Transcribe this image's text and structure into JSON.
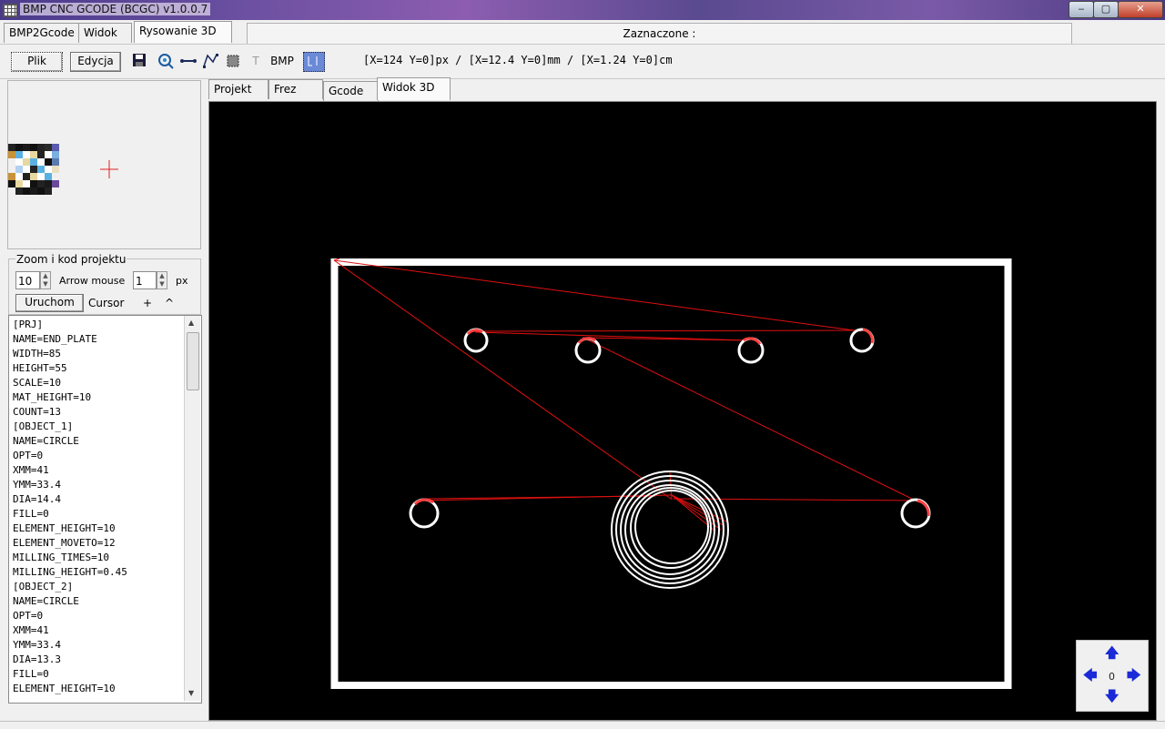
{
  "window": {
    "title": "BMP CNC GCODE (BCGC) v1.0.0.7",
    "min": "‒",
    "max": "▢",
    "close": "✕"
  },
  "top_tabs": [
    "BMP2Gcode",
    "Widok",
    "Rysowanie 3D"
  ],
  "selection_label": "Zaznaczone :",
  "toolbar": {
    "plik": "Plik",
    "edycja": "Edycja",
    "text_tool": "T",
    "bmp_tool": "BMP",
    "coords": "[X=124 Y=0]px / [X=12.4 Y=0]mm / [X=1.24 Y=0]cm"
  },
  "zoom_group": {
    "legend": "Zoom i kod projektu",
    "zoom_value": "10",
    "arrow_mouse_label": "Arrow mouse",
    "arrow_value": "1",
    "unit": "px",
    "run_button": "Uruchom",
    "cursor_label": "Cursor",
    "plus": "+",
    "caret": "^"
  },
  "code_lines": [
    "[PRJ]",
    "NAME=END_PLATE",
    "WIDTH=85",
    "HEIGHT=55",
    "SCALE=10",
    "MAT_HEIGHT=10",
    "COUNT=13",
    "[OBJECT_1]",
    "NAME=CIRCLE",
    "OPT=0",
    "XMM=41",
    "YMM=33.4",
    "DIA=14.4",
    "FILL=0",
    "ELEMENT_HEIGHT=10",
    "ELEMENT_MOVETO=12",
    "MILLING_TIMES=10",
    "MILLING_HEIGHT=0.45",
    "[OBJECT_2]",
    "NAME=CIRCLE",
    "OPT=0",
    "XMM=41",
    "YMM=33.4",
    "DIA=13.3",
    "FILL=0",
    "ELEMENT_HEIGHT=10"
  ],
  "inner_tabs": [
    "Projekt",
    "Frez",
    "Gcode",
    "Widok 3D"
  ],
  "nav_pad": {
    "center": "0",
    "up": "🡅",
    "down": "🡇",
    "left": "🡄",
    "right": "🡆"
  },
  "colors": {
    "toolpath": "#e01010",
    "outline": "#ffffff",
    "view_bg": "#000000",
    "arrow": "#1a2ad8"
  }
}
